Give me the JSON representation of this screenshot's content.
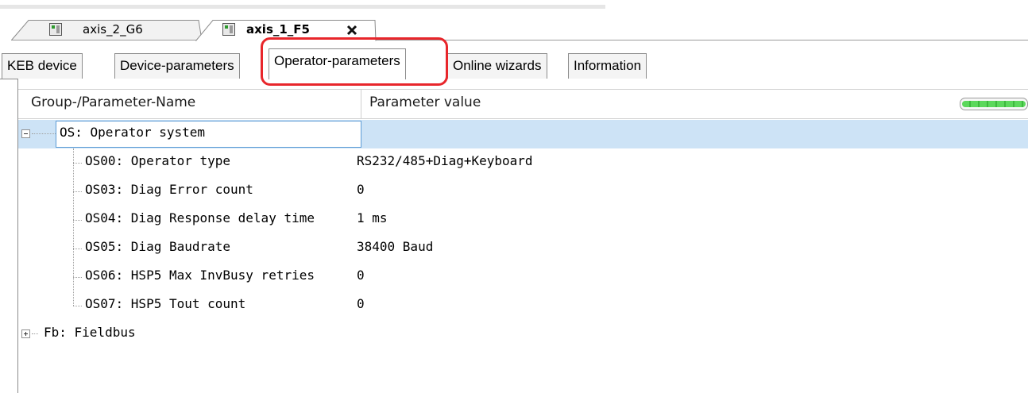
{
  "doc_tabs": [
    {
      "label": "axis_2_G6",
      "active": false
    },
    {
      "label": "axis_1_F5",
      "active": true
    }
  ],
  "inner_tabs": [
    {
      "label": "KEB device"
    },
    {
      "label": "Device-parameters"
    },
    {
      "label": "Operator-parameters",
      "active": true
    },
    {
      "label": "Online wizards"
    },
    {
      "label": "Information"
    }
  ],
  "grid": {
    "columns": {
      "name": "Group-/Parameter-Name",
      "value": "Parameter value"
    },
    "progress_fill": 1.0,
    "groups": [
      {
        "label": "OS: Operator system",
        "expanded": true,
        "selected": true,
        "params": [
          {
            "name": "OS00: Operator type",
            "value": "RS232/485+Diag+Keyboard"
          },
          {
            "name": "OS03: Diag Error count",
            "value": "0"
          },
          {
            "name": "OS04: Diag Response delay time",
            "value": "1 ms"
          },
          {
            "name": "OS05: Diag Baudrate",
            "value": "38400 Baud"
          },
          {
            "name": "OS06: HSP5 Max InvBusy retries",
            "value": "0"
          },
          {
            "name": "OS07: HSP5 Tout count",
            "value": "0"
          }
        ]
      },
      {
        "label": "Fb: Fieldbus",
        "expanded": false,
        "params": []
      }
    ]
  },
  "colors": {
    "highlight": "#e8262b",
    "selection": "#cde3f6",
    "selection_border": "#5b9bd5"
  },
  "icons": {
    "device": "device-icon",
    "close": "close-icon",
    "expand": "expand-icon",
    "collapse": "collapse-icon"
  }
}
